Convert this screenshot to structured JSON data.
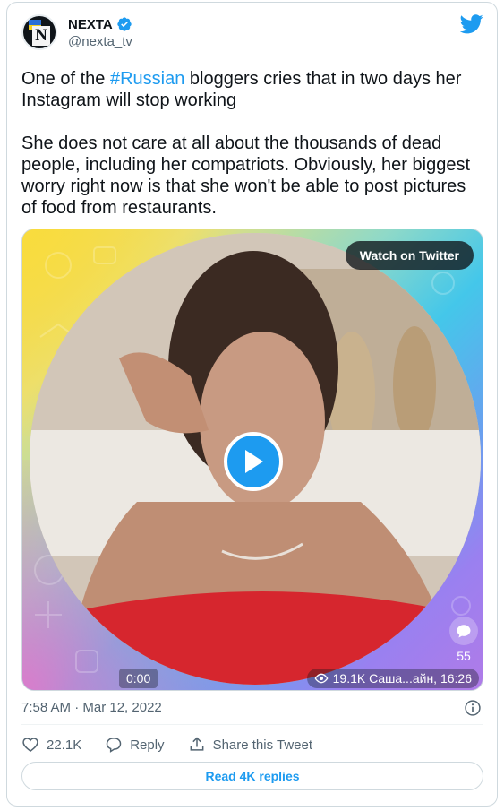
{
  "author": {
    "name": "NEXTA",
    "handle": "@nexta_tv",
    "avatar_letter": "N",
    "verified": true
  },
  "tweet": {
    "paragraphs": [
      {
        "before": "One of the ",
        "hashtag": "#Russian",
        "after": " bloggers cries that in two days her Instagram will stop working"
      },
      {
        "text": "She does not care at all about the thousands of dead people, including her compatriots. Obviously, her biggest worry right now is that she won't be able to post pictures of food from restaurants."
      }
    ]
  },
  "media": {
    "watch_label": "Watch on Twitter",
    "time": "0:00",
    "views": "19.1K Саша...айн, 16:26",
    "comments_count": "55"
  },
  "meta": {
    "timestamp": "7:58 AM · Mar 12, 2022"
  },
  "actions": {
    "likes": "22.1K",
    "reply_label": "Reply",
    "share_label": "Share this Tweet"
  },
  "read_replies": "Read 4K replies",
  "colors": {
    "accent": "#1d9bf0",
    "text": "#0f1419",
    "secondary": "#536471",
    "border": "#cfd9de"
  }
}
